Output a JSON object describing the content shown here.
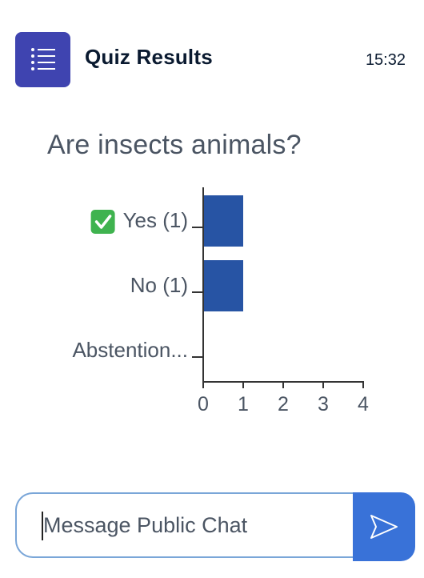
{
  "header": {
    "title": "Quiz Results",
    "time": "15:32",
    "icon": "list-icon",
    "icon_color": "#3f44b0"
  },
  "question": "Are insects animals?",
  "chart_data": {
    "type": "bar",
    "orientation": "horizontal",
    "categories": [
      "Yes (1)",
      "No (1)",
      "Abstention..."
    ],
    "values": [
      1,
      1,
      0
    ],
    "correct_category": "Yes (1)",
    "xticks": [
      "0",
      "1",
      "2",
      "3",
      "4"
    ],
    "xlim": [
      0,
      4
    ],
    "bar_color": "#2754a4",
    "grid": false
  },
  "composer": {
    "placeholder": "Message Public Chat",
    "send_icon": "send-icon",
    "send_color": "#3972d8"
  }
}
